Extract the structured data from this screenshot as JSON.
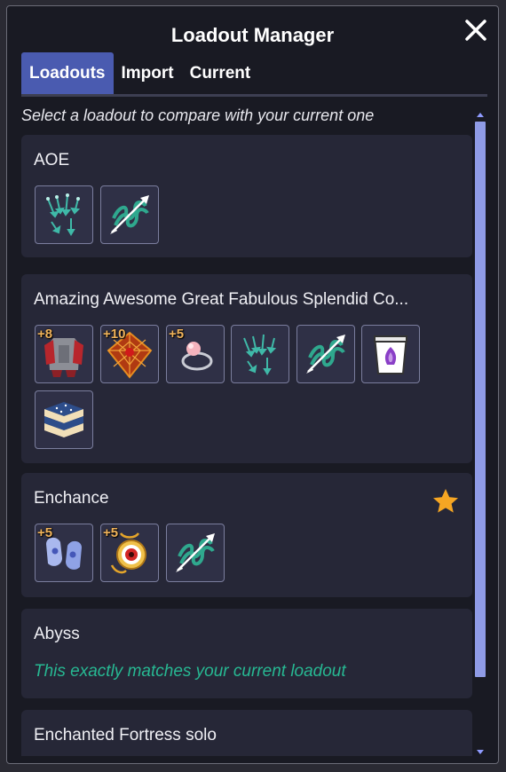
{
  "window": {
    "title": "Loadout Manager"
  },
  "tabs": [
    {
      "label": "Loadouts",
      "active": true
    },
    {
      "label": "Import",
      "active": false
    },
    {
      "label": "Current",
      "active": false
    }
  ],
  "hint": "Select a loadout to compare with your current one",
  "loadouts": [
    {
      "name": "AOE",
      "items": [
        {
          "icon": "arrow-volley-icon",
          "level": ""
        },
        {
          "icon": "helix-arrow-icon",
          "level": ""
        }
      ]
    },
    {
      "name": "Amazing Awesome Great Fabulous Splendid Co...",
      "items": [
        {
          "icon": "armor-icon",
          "level": "+8"
        },
        {
          "icon": "web-shield-icon",
          "level": "+10"
        },
        {
          "icon": "pearl-ring-icon",
          "level": "+5"
        },
        {
          "icon": "arrow-volley-icon",
          "level": ""
        },
        {
          "icon": "helix-arrow-icon",
          "level": ""
        },
        {
          "icon": "potion-cup-icon",
          "level": ""
        },
        {
          "icon": "layered-cake-icon",
          "level": ""
        }
      ]
    },
    {
      "name": "Enchance",
      "favorite": true,
      "items": [
        {
          "icon": "gloves-icon",
          "level": "+5"
        },
        {
          "icon": "eye-amulet-icon",
          "level": "+5"
        },
        {
          "icon": "helix-arrow-icon",
          "level": ""
        }
      ]
    },
    {
      "name": "Abyss",
      "match_text": "This exactly matches your current loadout"
    },
    {
      "name": "Enchanted Fortress solo"
    }
  ],
  "colors": {
    "accent": "#4a5bb0",
    "match": "#27b892",
    "level": "#f0b35a",
    "star": "#f6a623"
  }
}
